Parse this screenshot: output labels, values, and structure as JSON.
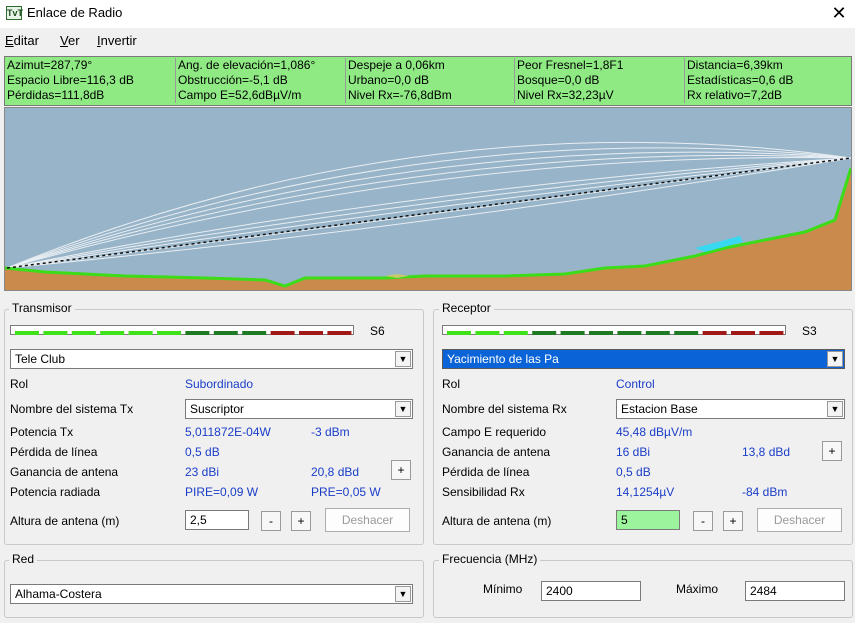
{
  "window": {
    "title": "Enlace de Radio",
    "icon_text": "TvT"
  },
  "menu": [
    {
      "label": "Editar",
      "hot": "E",
      "rest": "ditar"
    },
    {
      "label": "Ver",
      "hot": "V",
      "rest": "er"
    },
    {
      "label": "Invertir",
      "hot": "I",
      "rest": "nvertir"
    }
  ],
  "stats": [
    [
      "Azimut=287,79°",
      "Ang. de elevación=1,086°",
      "Despeje a 0,06km",
      "Peor Fresnel=1,8F1",
      "Distancia=6,39km"
    ],
    [
      "Espacio Libre=116,3 dB",
      "Obstrucción=-5,1 dB",
      "Urbano=0,0 dB",
      "Bosque=0,0 dB",
      "Estadísticas=0,6 dB"
    ],
    [
      "Pérdidas=111,8dB",
      "Campo E=52,6dBµV/m",
      "Nivel Rx=-76,8dBm",
      "Nivel Rx=32,23µV",
      "Rx relativo=7,2dB"
    ]
  ],
  "transmitter": {
    "legend": "Transmisor",
    "meter_label": "S6",
    "meter_level": 0.6,
    "station": "Tele Club",
    "role_label": "Rol",
    "role_value": "Subordinado",
    "system_label": "Nombre del sistema Tx",
    "system_value": "Suscriptor",
    "power_label": "Potencia Tx",
    "power_w": "5,011872E-04W",
    "power_dbm": "-3 dBm",
    "line_loss_label": "Pérdida de línea",
    "line_loss": "0,5 dB",
    "gain_label": "Ganancia de antena",
    "gain_dbi": "23 dBi",
    "gain_dbd": "20,8 dBd",
    "radiated_label": "Potencia radiada",
    "eirp": "PIRE=0,09 W",
    "erp": "PRE=0,05 W",
    "height_label": "Altura de antena (m)",
    "height_value": "2,5",
    "undo_label": "Deshacer",
    "plus": "+",
    "minus": "-"
  },
  "receiver": {
    "legend": "Receptor",
    "meter_label": "S3",
    "meter_level": 0.3,
    "station": "Yacimiento de las Pa",
    "role_label": "Rol",
    "role_value": "Control",
    "system_label": "Nombre del sistema Rx",
    "system_value": "Estacion Base",
    "field_label": "Campo E requerido",
    "field_value": "45,48 dBµV/m",
    "gain_label": "Ganancia de antena",
    "gain_dbi": "16 dBi",
    "gain_dbd": "13,8 dBd",
    "line_loss_label": "Pérdida de línea",
    "line_loss": "0,5 dB",
    "sens_label": "Sensibilidad Rx",
    "sens_uv": "14,1254µV",
    "sens_dbm": "-84 dBm",
    "height_label": "Altura de antena (m)",
    "height_value": "5",
    "undo_label": "Deshacer",
    "plus": "+",
    "minus": "-"
  },
  "network": {
    "legend": "Red",
    "value": "Alhama-Costera"
  },
  "frequency": {
    "legend": "Frecuencia (MHz)",
    "min_label": "Mínimo",
    "min_value": "2400",
    "max_label": "Máximo",
    "max_value": "2484"
  },
  "colors": {
    "stats_bg": "#8fea84",
    "sky": "#98b4c8",
    "terrain": "#c98a4b",
    "ground_line": "#3cdc18",
    "link_line": "#111111",
    "selection": "#0a64d8"
  }
}
